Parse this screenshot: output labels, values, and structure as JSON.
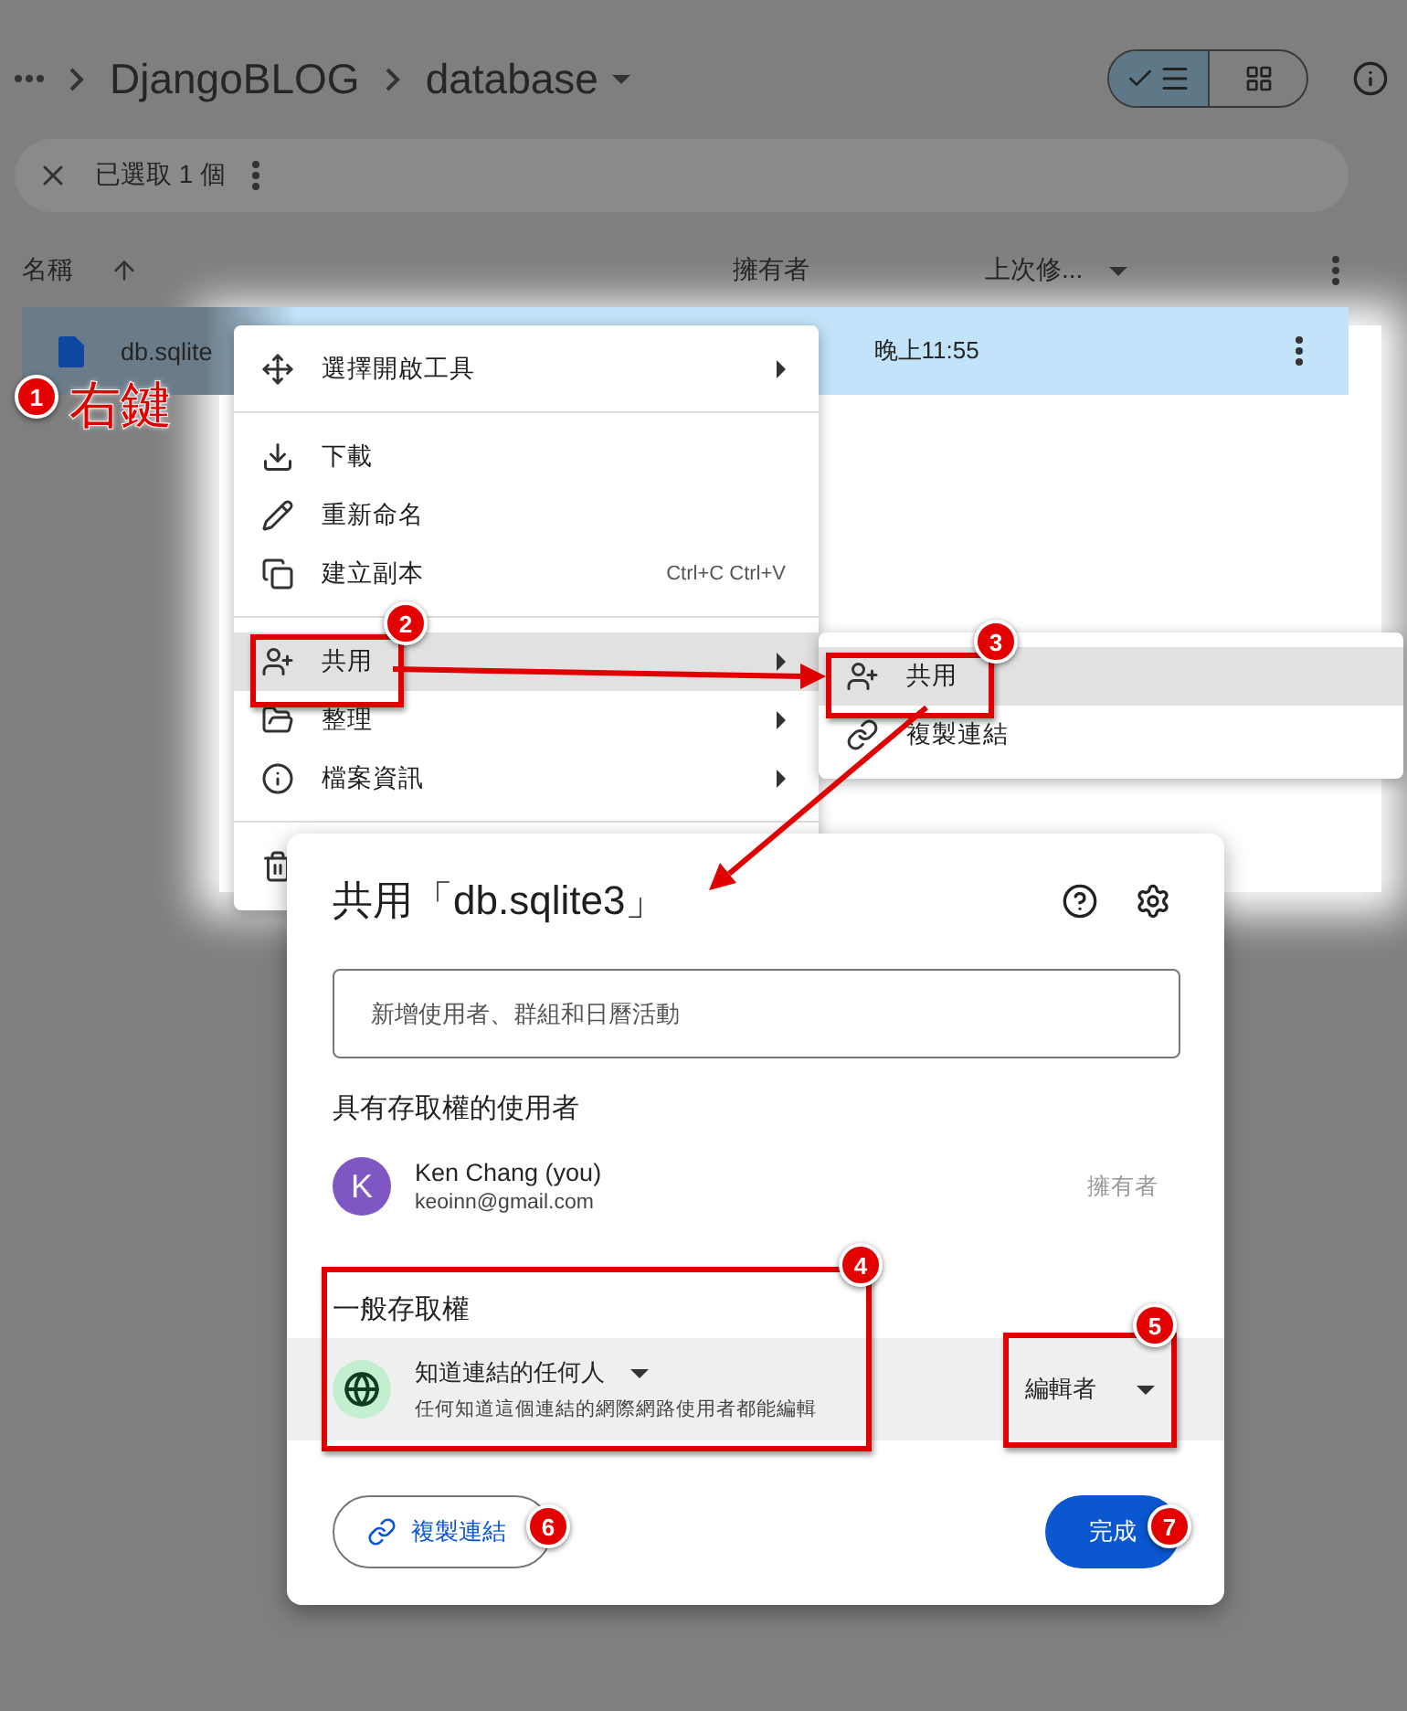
{
  "breadcrumb": {
    "parent": "DjangoBLOG",
    "current": "database"
  },
  "view_toggle": [
    {
      "kind": "list",
      "selected": true
    },
    {
      "kind": "grid",
      "selected": false
    }
  ],
  "selection_bar": {
    "count": "已選取 1 個"
  },
  "columns": {
    "name": "名稱",
    "owner": "擁有者",
    "modified": "上次修..."
  },
  "file_row": {
    "name": "db.sqlite",
    "modified": "晚上11:55",
    "selected": true
  },
  "context_menu": [
    [
      {
        "label": "選擇開啟工具",
        "submenu": true,
        "selected": false
      }
    ],
    [
      {
        "label": "下載",
        "submenu": false,
        "selected": false
      },
      {
        "label": "重新命名",
        "submenu": false,
        "selected": false
      },
      {
        "label": "建立副本",
        "shortcut": "Ctrl+C Ctrl+V",
        "submenu": false,
        "selected": false
      }
    ],
    [
      {
        "label": "共用",
        "submenu": true,
        "selected": true
      },
      {
        "label": "整理",
        "submenu": true,
        "selected": false
      },
      {
        "label": "檔案資訊",
        "submenu": true,
        "selected": false
      }
    ]
  ],
  "share_submenu": [
    {
      "label": "共用",
      "selected": true
    },
    {
      "label": "複製連結",
      "selected": false
    }
  ],
  "dialog": {
    "title": "共用「db.sqlite3」",
    "placeholder": "新增使用者、群組和日曆活動",
    "people_heading": "具有存取權的使用者",
    "people": [
      {
        "initial": "K",
        "name": "Ken Chang (you)",
        "email": "keoinn@gmail.com",
        "role": "擁有者",
        "color": "#7e57c2"
      }
    ],
    "general_heading": "一般存取權",
    "scope": "知道連結的任何人",
    "scope_description": "任何知道這個連結的網際網路使用者都能編輯",
    "role": "編輯者",
    "copy_link": "複製連結",
    "done": "完成"
  },
  "annotations": {
    "right_click": "右鍵",
    "badges": [
      "1",
      "2",
      "3",
      "4",
      "5",
      "6",
      "7"
    ]
  }
}
